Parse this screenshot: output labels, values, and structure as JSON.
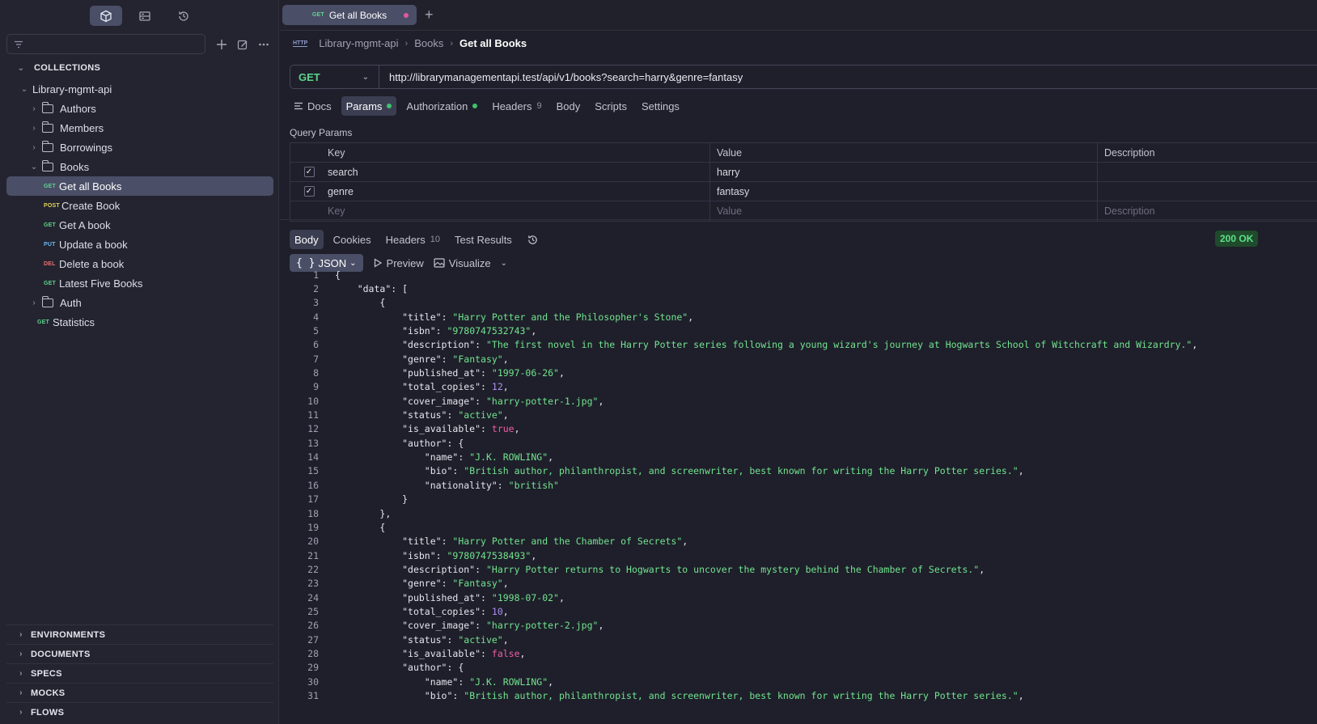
{
  "sidebar": {
    "filter_placeholder": "",
    "collections_label": "COLLECTIONS",
    "tree": {
      "root": "Library-mgmt-api",
      "folders": [
        "Authors",
        "Members",
        "Borrowings"
      ],
      "books_folder": "Books",
      "books_requests": [
        {
          "method": "GET",
          "label": "Get all Books"
        },
        {
          "method": "POST",
          "label": "Create Book"
        },
        {
          "method": "GET",
          "label": "Get A book"
        },
        {
          "method": "PUT",
          "label": "Update a book"
        },
        {
          "method": "DEL",
          "label": "Delete a book"
        },
        {
          "method": "GET",
          "label": "Latest Five Books"
        }
      ],
      "auth_folder": "Auth",
      "statistics": {
        "method": "GET",
        "label": "Statistics"
      }
    },
    "bottom_sections": [
      "ENVIRONMENTS",
      "DOCUMENTS",
      "SPECS",
      "MOCKS",
      "FLOWS"
    ]
  },
  "tabbar": {
    "tab_method": "GET",
    "tab_label": "Get all Books"
  },
  "breadcrumb": {
    "icon_text": "HTTP",
    "items": [
      "Library-mgmt-api",
      "Books",
      "Get all Books"
    ]
  },
  "request": {
    "method": "GET",
    "url": "http://librarymanagementapi.test/api/v1/books?search=harry&genre=fantasy",
    "tabs": {
      "docs": "Docs",
      "params": "Params",
      "authorization": "Authorization",
      "headers": "Headers",
      "headers_count": "9",
      "body": "Body",
      "scripts": "Scripts",
      "settings": "Settings"
    },
    "query_params_title": "Query Params",
    "query_params_headers": {
      "key": "Key",
      "value": "Value",
      "description": "Description"
    },
    "query_params": [
      {
        "key": "search",
        "value": "harry",
        "description": ""
      },
      {
        "key": "genre",
        "value": "fantasy",
        "description": ""
      }
    ],
    "query_params_placeholders": {
      "key": "Key",
      "value": "Value",
      "description": "Description"
    }
  },
  "response": {
    "tabs": {
      "body": "Body",
      "cookies": "Cookies",
      "headers": "Headers",
      "headers_count": "10",
      "test_results": "Test Results"
    },
    "status": "200 OK",
    "format": "JSON",
    "preview": "Preview",
    "visualize": "Visualize"
  },
  "code_lines": [
    {
      "n": "1",
      "indent": 0,
      "parts": [
        [
          "p",
          "{"
        ]
      ]
    },
    {
      "n": "2",
      "indent": 1,
      "parts": [
        [
          "k",
          "\"data\""
        ],
        [
          "p",
          ": ["
        ]
      ]
    },
    {
      "n": "3",
      "indent": 2,
      "parts": [
        [
          "p",
          "{"
        ]
      ]
    },
    {
      "n": "4",
      "indent": 3,
      "parts": [
        [
          "k",
          "\"title\""
        ],
        [
          "p",
          ": "
        ],
        [
          "s",
          "\"Harry Potter and the Philosopher's Stone\""
        ],
        [
          "p",
          ","
        ]
      ]
    },
    {
      "n": "5",
      "indent": 3,
      "parts": [
        [
          "k",
          "\"isbn\""
        ],
        [
          "p",
          ": "
        ],
        [
          "s",
          "\"9780747532743\""
        ],
        [
          "p",
          ","
        ]
      ]
    },
    {
      "n": "6",
      "indent": 3,
      "parts": [
        [
          "k",
          "\"description\""
        ],
        [
          "p",
          ": "
        ],
        [
          "s",
          "\"The first novel in the Harry Potter series following a young wizard's journey at Hogwarts School of Witchcraft and Wizardry.\""
        ],
        [
          "p",
          ","
        ]
      ]
    },
    {
      "n": "7",
      "indent": 3,
      "parts": [
        [
          "k",
          "\"genre\""
        ],
        [
          "p",
          ": "
        ],
        [
          "s",
          "\"Fantasy\""
        ],
        [
          "p",
          ","
        ]
      ]
    },
    {
      "n": "8",
      "indent": 3,
      "parts": [
        [
          "k",
          "\"published_at\""
        ],
        [
          "p",
          ": "
        ],
        [
          "s",
          "\"1997-06-26\""
        ],
        [
          "p",
          ","
        ]
      ]
    },
    {
      "n": "9",
      "indent": 3,
      "parts": [
        [
          "k",
          "\"total_copies\""
        ],
        [
          "p",
          ": "
        ],
        [
          "n",
          "12"
        ],
        [
          "p",
          ","
        ]
      ]
    },
    {
      "n": "10",
      "indent": 3,
      "parts": [
        [
          "k",
          "\"cover_image\""
        ],
        [
          "p",
          ": "
        ],
        [
          "s",
          "\"harry-potter-1.jpg\""
        ],
        [
          "p",
          ","
        ]
      ]
    },
    {
      "n": "11",
      "indent": 3,
      "parts": [
        [
          "k",
          "\"status\""
        ],
        [
          "p",
          ": "
        ],
        [
          "s",
          "\"active\""
        ],
        [
          "p",
          ","
        ]
      ]
    },
    {
      "n": "12",
      "indent": 3,
      "parts": [
        [
          "k",
          "\"is_available\""
        ],
        [
          "p",
          ": "
        ],
        [
          "b",
          "true"
        ],
        [
          "p",
          ","
        ]
      ]
    },
    {
      "n": "13",
      "indent": 3,
      "parts": [
        [
          "k",
          "\"author\""
        ],
        [
          "p",
          ": {"
        ]
      ]
    },
    {
      "n": "14",
      "indent": 4,
      "parts": [
        [
          "k",
          "\"name\""
        ],
        [
          "p",
          ": "
        ],
        [
          "s",
          "\"J.K. ROWLING\""
        ],
        [
          "p",
          ","
        ]
      ]
    },
    {
      "n": "15",
      "indent": 4,
      "parts": [
        [
          "k",
          "\"bio\""
        ],
        [
          "p",
          ": "
        ],
        [
          "s",
          "\"British author, philanthropist, and screenwriter, best known for writing the Harry Potter series.\""
        ],
        [
          "p",
          ","
        ]
      ]
    },
    {
      "n": "16",
      "indent": 4,
      "parts": [
        [
          "k",
          "\"nationality\""
        ],
        [
          "p",
          ": "
        ],
        [
          "s",
          "\"british\""
        ]
      ]
    },
    {
      "n": "17",
      "indent": 3,
      "parts": [
        [
          "p",
          "}"
        ]
      ]
    },
    {
      "n": "18",
      "indent": 2,
      "parts": [
        [
          "p",
          "},"
        ]
      ]
    },
    {
      "n": "19",
      "indent": 2,
      "parts": [
        [
          "p",
          "{"
        ]
      ]
    },
    {
      "n": "20",
      "indent": 3,
      "parts": [
        [
          "k",
          "\"title\""
        ],
        [
          "p",
          ": "
        ],
        [
          "s",
          "\"Harry Potter and the Chamber of Secrets\""
        ],
        [
          "p",
          ","
        ]
      ]
    },
    {
      "n": "21",
      "indent": 3,
      "parts": [
        [
          "k",
          "\"isbn\""
        ],
        [
          "p",
          ": "
        ],
        [
          "s",
          "\"9780747538493\""
        ],
        [
          "p",
          ","
        ]
      ]
    },
    {
      "n": "22",
      "indent": 3,
      "parts": [
        [
          "k",
          "\"description\""
        ],
        [
          "p",
          ": "
        ],
        [
          "s",
          "\"Harry Potter returns to Hogwarts to uncover the mystery behind the Chamber of Secrets.\""
        ],
        [
          "p",
          ","
        ]
      ]
    },
    {
      "n": "23",
      "indent": 3,
      "parts": [
        [
          "k",
          "\"genre\""
        ],
        [
          "p",
          ": "
        ],
        [
          "s",
          "\"Fantasy\""
        ],
        [
          "p",
          ","
        ]
      ]
    },
    {
      "n": "24",
      "indent": 3,
      "parts": [
        [
          "k",
          "\"published_at\""
        ],
        [
          "p",
          ": "
        ],
        [
          "s",
          "\"1998-07-02\""
        ],
        [
          "p",
          ","
        ]
      ]
    },
    {
      "n": "25",
      "indent": 3,
      "parts": [
        [
          "k",
          "\"total_copies\""
        ],
        [
          "p",
          ": "
        ],
        [
          "n",
          "10"
        ],
        [
          "p",
          ","
        ]
      ]
    },
    {
      "n": "26",
      "indent": 3,
      "parts": [
        [
          "k",
          "\"cover_image\""
        ],
        [
          "p",
          ": "
        ],
        [
          "s",
          "\"harry-potter-2.jpg\""
        ],
        [
          "p",
          ","
        ]
      ]
    },
    {
      "n": "27",
      "indent": 3,
      "parts": [
        [
          "k",
          "\"status\""
        ],
        [
          "p",
          ": "
        ],
        [
          "s",
          "\"active\""
        ],
        [
          "p",
          ","
        ]
      ]
    },
    {
      "n": "28",
      "indent": 3,
      "parts": [
        [
          "k",
          "\"is_available\""
        ],
        [
          "p",
          ": "
        ],
        [
          "b",
          "false"
        ],
        [
          "p",
          ","
        ]
      ]
    },
    {
      "n": "29",
      "indent": 3,
      "parts": [
        [
          "k",
          "\"author\""
        ],
        [
          "p",
          ": {"
        ]
      ]
    },
    {
      "n": "30",
      "indent": 4,
      "parts": [
        [
          "k",
          "\"name\""
        ],
        [
          "p",
          ": "
        ],
        [
          "s",
          "\"J.K. ROWLING\""
        ],
        [
          "p",
          ","
        ]
      ]
    },
    {
      "n": "31",
      "indent": 4,
      "parts": [
        [
          "k",
          "\"bio\""
        ],
        [
          "p",
          ": "
        ],
        [
          "s",
          "\"British author, philanthropist, and screenwriter, best known for writing the Harry Potter series.\""
        ],
        [
          "p",
          ","
        ]
      ]
    }
  ],
  "colors": {
    "accent_selected": "#4a4e66",
    "get": "#5ed48a",
    "post": "#e5d35a",
    "put": "#6fb8ee",
    "del": "#ef6f6f",
    "status_ok": "#5ee08a",
    "string": "#72e38f",
    "number": "#b08ef4",
    "boolean": "#ef5da8"
  }
}
